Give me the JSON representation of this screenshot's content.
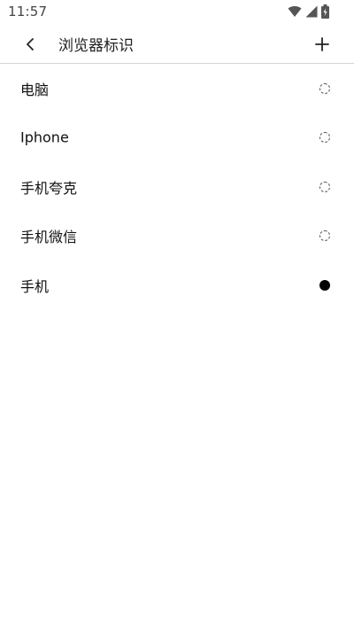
{
  "status_bar": {
    "time": "11:57",
    "icons": [
      "wifi-icon",
      "signal-icon",
      "battery-icon"
    ]
  },
  "app_bar": {
    "back_icon": "chevron-left-icon",
    "title": "浏览器标识",
    "add_icon": "plus-icon"
  },
  "user_agents": [
    {
      "label": "电脑",
      "selected": false
    },
    {
      "label": "Iphone",
      "selected": false
    },
    {
      "label": "手机夸克",
      "selected": false
    },
    {
      "label": "手机微信",
      "selected": false
    },
    {
      "label": "手机",
      "selected": true
    }
  ],
  "colors": {
    "divider": "#d6d6d6",
    "selected_radio": "#000000",
    "text": "#111111"
  }
}
